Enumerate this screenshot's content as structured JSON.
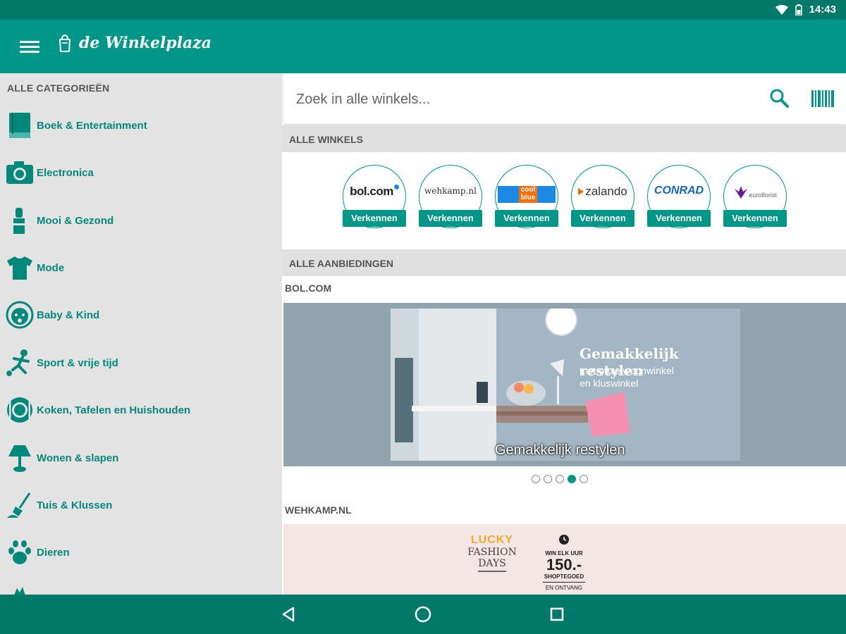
{
  "status": {
    "time": "14:43"
  },
  "app": {
    "title": "de Winkelplaza",
    "accent": "#009688",
    "dark_accent": "#00796b"
  },
  "sidebar": {
    "heading": "ALLE CATEGORIEËN",
    "items": [
      {
        "label": "Boek & Entertainment",
        "icon": "book-icon"
      },
      {
        "label": "Electronica",
        "icon": "camera-icon"
      },
      {
        "label": "Mooi & Gezond",
        "icon": "lipstick-icon"
      },
      {
        "label": "Mode",
        "icon": "shirt-icon"
      },
      {
        "label": "Baby & Kind",
        "icon": "baby-icon"
      },
      {
        "label": "Sport & vrije tijd",
        "icon": "soccer-icon"
      },
      {
        "label": "Koken, Tafelen en Huishouden",
        "icon": "plate-icon"
      },
      {
        "label": "Wonen & slapen",
        "icon": "lamp-icon"
      },
      {
        "label": "Tuis & Klussen",
        "icon": "shovel-icon"
      },
      {
        "label": "Dieren",
        "icon": "paw-icon"
      }
    ]
  },
  "search": {
    "placeholder": "Zoek in alle winkels..."
  },
  "sections": {
    "shops": "ALLE WINKELS",
    "offers": "ALLE AANBIEDINGEN"
  },
  "shops": [
    {
      "name": "bol.com",
      "button": "Verkennen"
    },
    {
      "name": "wehkamp.nl",
      "button": "Verkennen"
    },
    {
      "name": "cool blue",
      "button": "Verkennen"
    },
    {
      "name": "zalando",
      "button": "Verkennen"
    },
    {
      "name": "CONRAD",
      "button": "Verkennen"
    },
    {
      "name": "euroflorist",
      "button": "Verkennen"
    }
  ],
  "offers": [
    {
      "store": "BOL.COM",
      "headline": "Gemakkelijk restylen",
      "sub1": "met onze woonwinkel",
      "sub2": "en kluswinkel",
      "caption": "Gemakkelijk restylen",
      "slides": 5,
      "active_slide": 4
    },
    {
      "store": "WEHKAMP.NL",
      "lucky": "LUCKY",
      "fashion": "FASHION",
      "days": "DAYS",
      "win": "WIN ELK UUR",
      "amount": "150.-",
      "shoptegoed": "SHOPTEGOED",
      "ontvang": "EN ONTVANG"
    }
  ]
}
